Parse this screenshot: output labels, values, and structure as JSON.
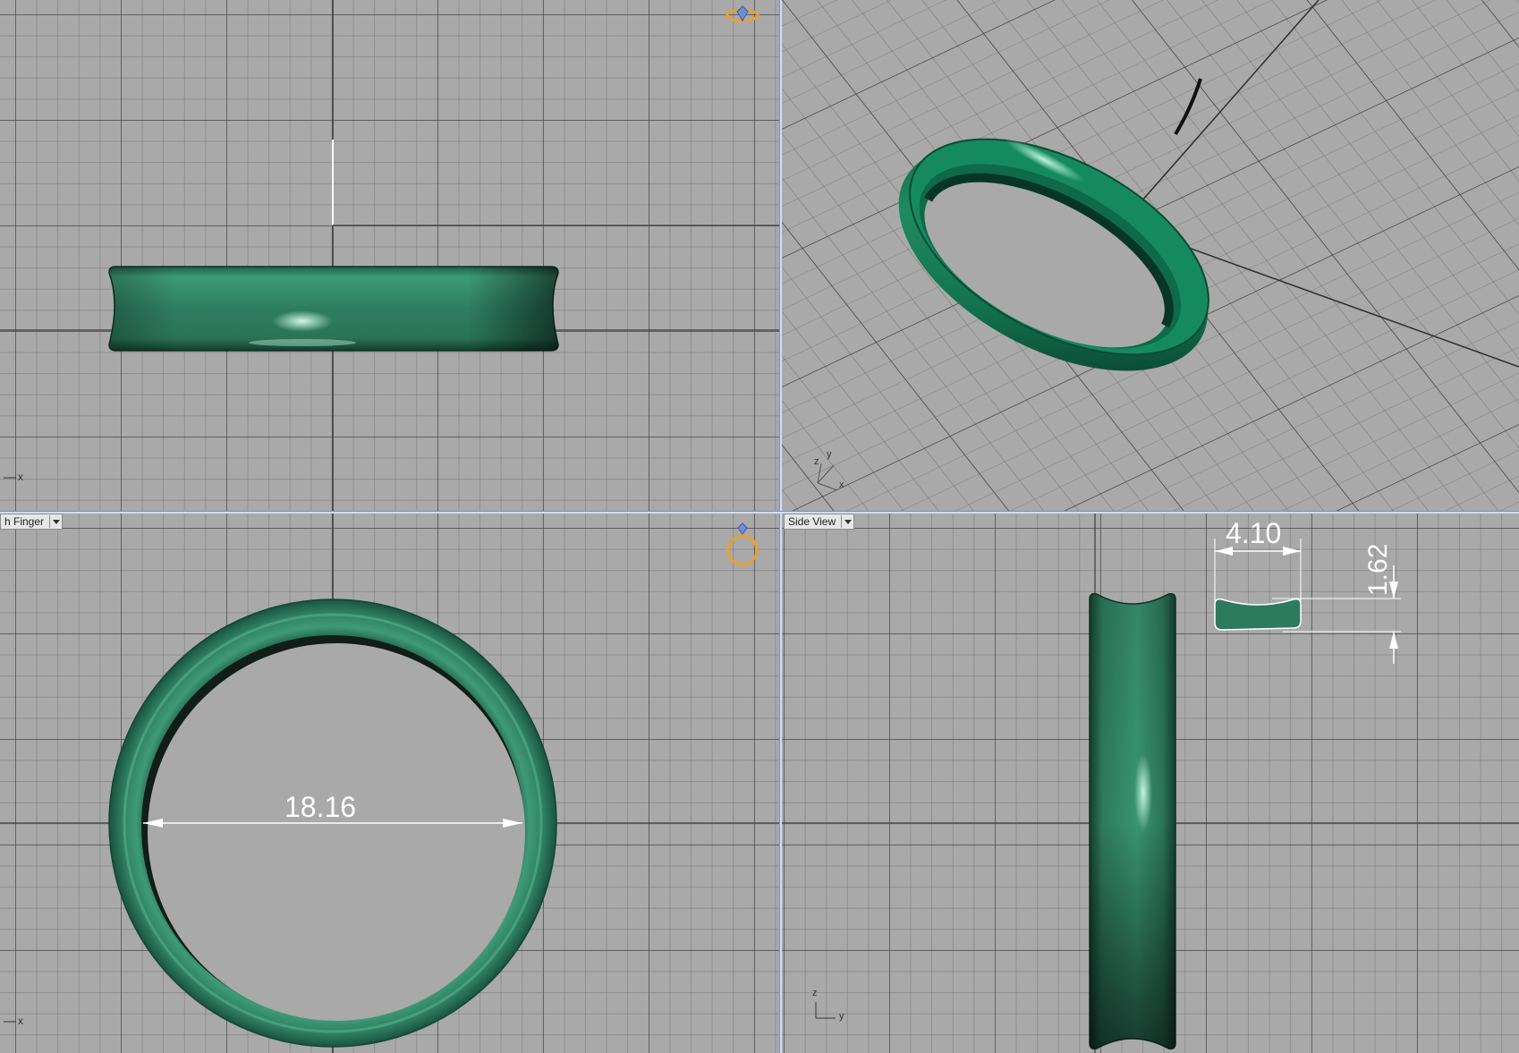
{
  "viewports": {
    "top_left": {
      "axis_x": "x"
    },
    "top_right": {
      "axis_z": "z",
      "axis_y": "y",
      "axis_x": "x"
    },
    "bottom_left": {
      "label": "h Finger",
      "axis_x": "x"
    },
    "bottom_right": {
      "label": "Side View",
      "axis_z": "z",
      "axis_y": "y"
    }
  },
  "dimensions": {
    "inner_diameter": "18.16",
    "width": "4.10",
    "thickness": "1.62"
  },
  "colors": {
    "ring": "#2a7a5e",
    "grid_background": "#a9a9a9",
    "view_gizmo": "#e8a030",
    "dimension": "#ffffff"
  },
  "icons": {
    "gizmo_top": "ring-gem-icon",
    "gizmo_bottom": "ring-top-icon"
  }
}
